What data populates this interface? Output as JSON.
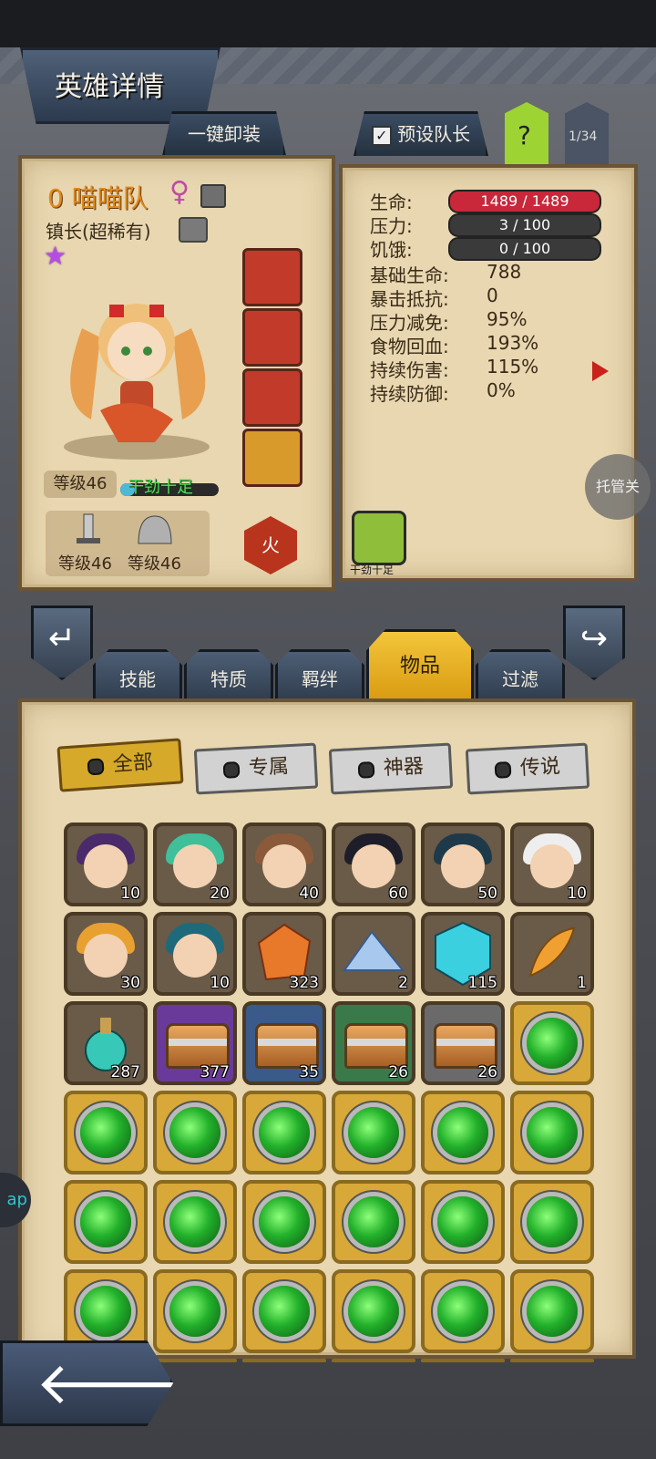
{
  "header": {
    "title": "英雄详情",
    "unequip_all": "一键卸装",
    "preset_captain": "预设队长",
    "help": "?",
    "page_counter": "1/34"
  },
  "hero": {
    "name": "0 喵喵队",
    "gender": "♀",
    "class": "镇长(超稀有)",
    "level": "等级46",
    "trait": "干劲十足",
    "trait_progress": 0.15,
    "weapon_level": "等级46",
    "armor_level": "等级46",
    "element": "火"
  },
  "stats": {
    "hp_label": "生命:",
    "hp_value": "1489 / 1489",
    "stress_label": "压力:",
    "stress_value": "3 / 100",
    "hunger_label": "饥饿:",
    "hunger_value": "0 / 100",
    "rows": [
      {
        "label": "基础生命:",
        "value": "788"
      },
      {
        "label": "暴击抵抗:",
        "value": "0"
      },
      {
        "label": "压力减免:",
        "value": "95%"
      },
      {
        "label": "食物回血:",
        "value": "193%"
      },
      {
        "label": "持续伤害:",
        "value": "115%"
      },
      {
        "label": "持续防御:",
        "value": "0%"
      }
    ],
    "trait_icon_label": "干劲十足",
    "auto_label": "托管关"
  },
  "tabs": [
    "技能",
    "特质",
    "羁绊",
    "物品",
    "过滤"
  ],
  "filters": [
    "全部",
    "专属",
    "神器",
    "传说"
  ],
  "items_row1": [
    {
      "count": "10",
      "hair": "#4a2a6a",
      "border": "#4a3a25"
    },
    {
      "count": "20",
      "hair": "#3fbf9a",
      "border": "#4a3a25"
    },
    {
      "count": "40",
      "hair": "#8a5a3a",
      "border": "#4a3a25"
    },
    {
      "count": "60",
      "hair": "#1e1e2a",
      "border": "#4a3a25"
    },
    {
      "count": "50",
      "hair": "#1e3a4a",
      "border": "#4a3a25"
    },
    {
      "count": "10",
      "hair": "#eeeeee",
      "border": "#4a3a25"
    }
  ],
  "items_row2": [
    {
      "count": "30",
      "kind": "hero",
      "hair": "#e8a030"
    },
    {
      "count": "10",
      "kind": "hero",
      "hair": "#1e6a7a"
    },
    {
      "count": "323",
      "kind": "crystal-orange"
    },
    {
      "count": "2",
      "kind": "crystal-blue"
    },
    {
      "count": "115",
      "kind": "rune-cyan"
    },
    {
      "count": "1",
      "kind": "feather"
    }
  ],
  "items_row3": [
    {
      "count": "287",
      "kind": "potion"
    },
    {
      "count": "377",
      "kind": "chest",
      "bg": "#6a3a9a"
    },
    {
      "count": "35",
      "kind": "chest",
      "bg": "#3a5a8a"
    },
    {
      "count": "26",
      "kind": "chest",
      "bg": "#3a7a4a"
    },
    {
      "count": "26",
      "kind": "chest",
      "bg": "#6a6a6a"
    },
    {
      "count": "",
      "kind": "gem"
    }
  ],
  "side_tab": "ap",
  "back_arrow": "🡐"
}
